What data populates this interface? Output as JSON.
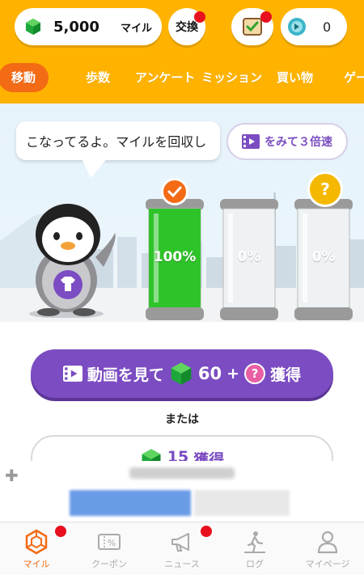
{
  "header": {
    "miles_value": "5,000",
    "miles_unit": "マイル",
    "exchange_label": "交換",
    "ticket_value": "0"
  },
  "tabs": [
    {
      "label": "移動",
      "active": true
    },
    {
      "label": "歩数"
    },
    {
      "label": "アンケート"
    },
    {
      "label": "ミッション"
    },
    {
      "label": "買い物"
    },
    {
      "label": "ゲー"
    }
  ],
  "scene": {
    "bubble_text": "こなってるよ。マイルを回収し",
    "speed_button": "をみて３倍速",
    "jars": [
      {
        "label": "100%",
        "fill": 1.0
      },
      {
        "label": "0%",
        "fill": 0.0
      },
      {
        "label": "0%",
        "fill": 0.0
      }
    ],
    "question_mark": "?"
  },
  "actions": {
    "watch_text_pre": "動画を見て",
    "watch_value": "60",
    "watch_plus": "+",
    "watch_text_post": "獲得",
    "or_text": "または",
    "earn_value": "15",
    "earn_label": "獲得"
  },
  "bottom_nav": [
    {
      "label": "マイル",
      "icon": "miles-hex-icon",
      "active": true
    },
    {
      "label": "クーポン",
      "icon": "coupon-icon"
    },
    {
      "label": "ニュース",
      "icon": "megaphone-icon"
    },
    {
      "label": "ログ",
      "icon": "walker-icon"
    },
    {
      "label": "マイページ",
      "icon": "person-icon"
    }
  ],
  "colors": {
    "header": "#ffb300",
    "accent_orange": "#f36b14",
    "purple": "#7b4cc2",
    "badge_red": "#e8101e",
    "green": "#2fc32a"
  }
}
